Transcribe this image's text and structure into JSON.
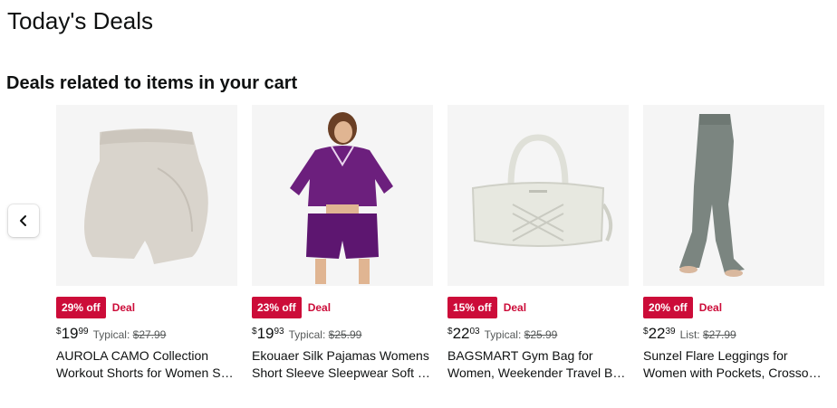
{
  "page": {
    "title": "Today's Deals"
  },
  "section": {
    "title": "Deals related to items in your cart"
  },
  "carousel": {
    "prev_icon": "chevron-left-icon"
  },
  "colors": {
    "deal_red": "#cc0c39",
    "image_bg": "#f5f5f5",
    "muted_text": "#565959"
  },
  "products": [
    {
      "discount": "29% off",
      "deal": "Deal",
      "currency": "$",
      "price_whole": "19",
      "price_fraction": "99",
      "list_label": "Typical:",
      "list_price": "$27.99",
      "title_line1": "AUROLA CAMO Collection",
      "title_line2": "Workout Shorts for Women Seamless Scrunch"
    },
    {
      "discount": "23% off",
      "deal": "Deal",
      "currency": "$",
      "price_whole": "19",
      "price_fraction": "93",
      "list_label": "Typical:",
      "list_price": "$25.99",
      "title_line1": "Ekouaer Silk Pajamas Womens",
      "title_line2": "Short Sleeve Sleepwear Soft Satin Button"
    },
    {
      "discount": "15% off",
      "deal": "Deal",
      "currency": "$",
      "price_whole": "22",
      "price_fraction": "03",
      "list_label": "Typical:",
      "list_price": "$25.99",
      "title_line1": "BAGSMART Gym Bag for",
      "title_line2": "Women, Weekender Travel Bag Carry On"
    },
    {
      "discount": "20% off",
      "deal": "Deal",
      "currency": "$",
      "price_whole": "22",
      "price_fraction": "39",
      "list_label": "List:",
      "list_price": "$27.99",
      "title_line1": "Sunzel Flare Leggings for",
      "title_line2": "Women with Pockets, Crossover High Waisted"
    }
  ]
}
